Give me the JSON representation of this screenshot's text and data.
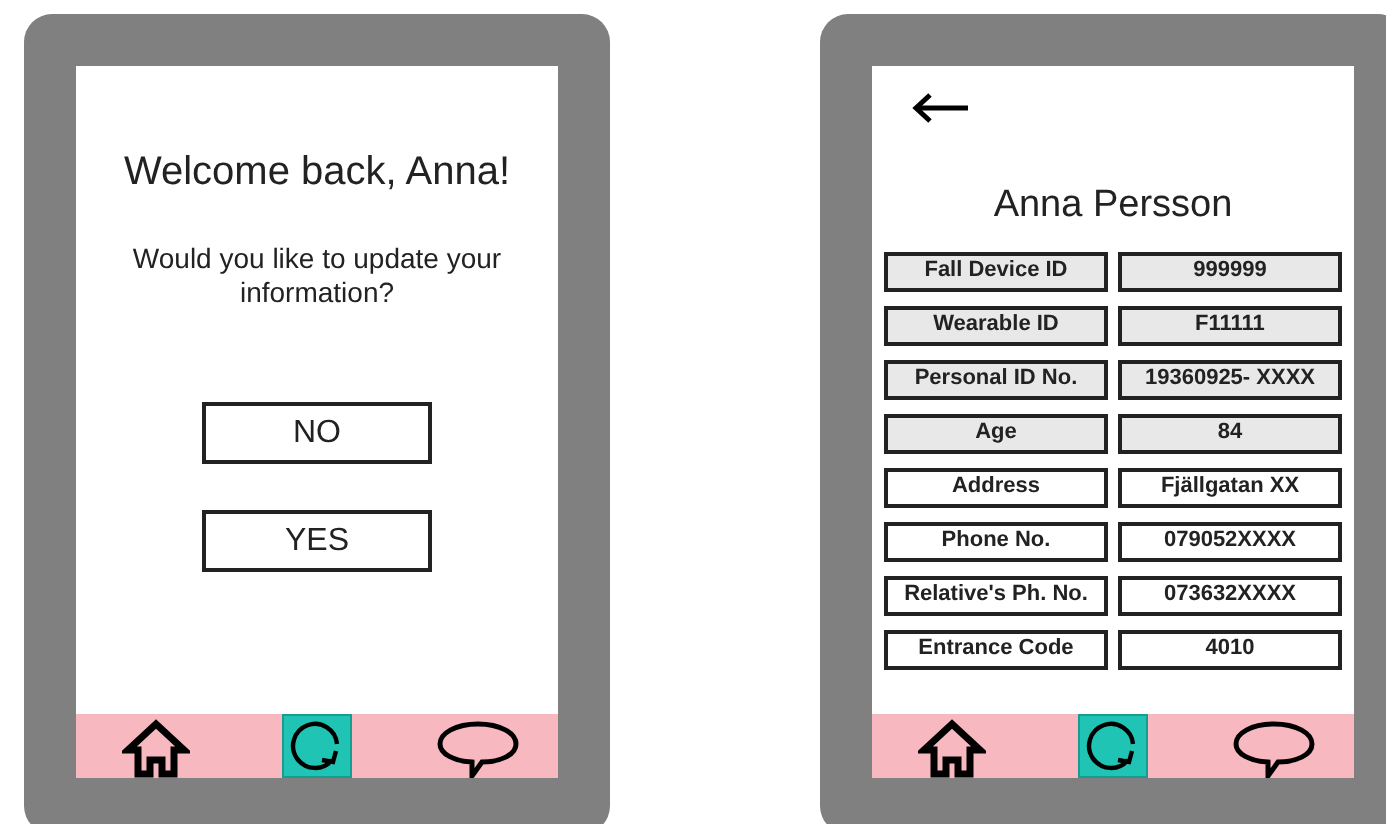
{
  "screens": [
    {
      "kind": "prompt",
      "title": "Welcome back, Anna!",
      "question": "Would you like to update your information?",
      "buttons": [
        "NO",
        "YES"
      ],
      "nav": [
        {
          "kind": "home",
          "selected": false
        },
        {
          "kind": "refresh",
          "selected": true
        },
        {
          "kind": "chat",
          "selected": false
        }
      ]
    },
    {
      "kind": "profile",
      "title": "Anna Persson",
      "rows": [
        {
          "label": "Fall Device ID",
          "value": "999999",
          "locked": true
        },
        {
          "label": "Wearable ID",
          "value": "F11111",
          "locked": true
        },
        {
          "label": "Personal ID No.",
          "value": "19360925- XXXX",
          "locked": true
        },
        {
          "label": "Age",
          "value": "84",
          "locked": true
        },
        {
          "label": "Address",
          "value": "Fjällgatan XX",
          "locked": false
        },
        {
          "label": "Phone No.",
          "value": "079052XXXX",
          "locked": false
        },
        {
          "label": "Relative's Ph. No.",
          "value": "073632XXXX",
          "locked": false
        },
        {
          "label": "Entrance Code",
          "value": "4010",
          "locked": false
        }
      ],
      "nav": [
        {
          "kind": "home",
          "selected": false
        },
        {
          "kind": "refresh",
          "selected": true
        },
        {
          "kind": "chat",
          "selected": false
        }
      ]
    }
  ]
}
